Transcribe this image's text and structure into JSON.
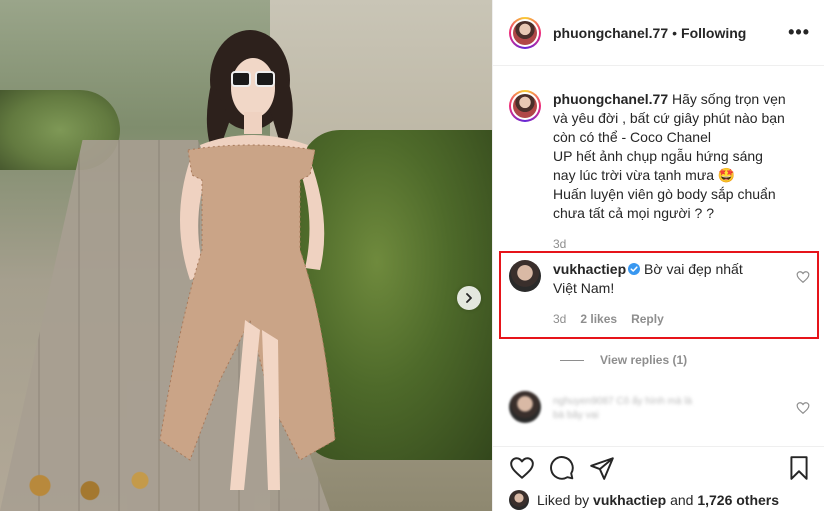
{
  "post": {
    "username": "phuongchanel.77",
    "separator": "•",
    "follow_status": "Following",
    "more_label": "•••"
  },
  "caption": {
    "username": "phuongchanel.77",
    "text": "Hãy sống trọn vẹn và yêu đời , bất cứ giây phút nào bạn còn có thể - Coco Chanel UP hết ảnh chụp ngẫu hứng sáng nay lúc trời vừa tạnh mưa 🤩 Huấn luyện viên gò body sắp chuẩn chưa tất cả mọi người ? ?",
    "lines": [
      "Hãy sống trọn vẹn",
      "và yêu đời , bất cứ giây phút nào bạn",
      "còn có thể - Coco Chanel",
      "UP hết ảnh chụp ngẫu hứng sáng",
      "nay lúc trời vừa tạnh mưa 🤩",
      "Huấn luyện viên gò body sắp chuẩn",
      "chưa tất cả mọi người ? ?"
    ],
    "time": "3d"
  },
  "highlighted_comment": {
    "username": "vukhactiep",
    "verified": true,
    "text_line1": "Bờ vai đẹp nhất",
    "text_line2": "Việt Nam!",
    "time": "3d",
    "likes": "2 likes",
    "reply": "Reply"
  },
  "view_replies": "View replies (1)",
  "blurred_comment": {
    "line1": "nghuyen9087 Cô ấy hình mà là",
    "line2": "bà bây vai"
  },
  "liked_by": {
    "prefix": "Liked by",
    "user": "vukhactiep",
    "conjunction": "and",
    "others": "1,726 others"
  },
  "colors": {
    "highlight_border": "#e6141a",
    "verified_blue": "#3897f0",
    "meta_gray": "#8e8e8e"
  },
  "icons": [
    "more-icon",
    "heart-icon",
    "comment-icon",
    "share-icon",
    "bookmark-icon",
    "verified-icon",
    "chevron-right-icon"
  ]
}
